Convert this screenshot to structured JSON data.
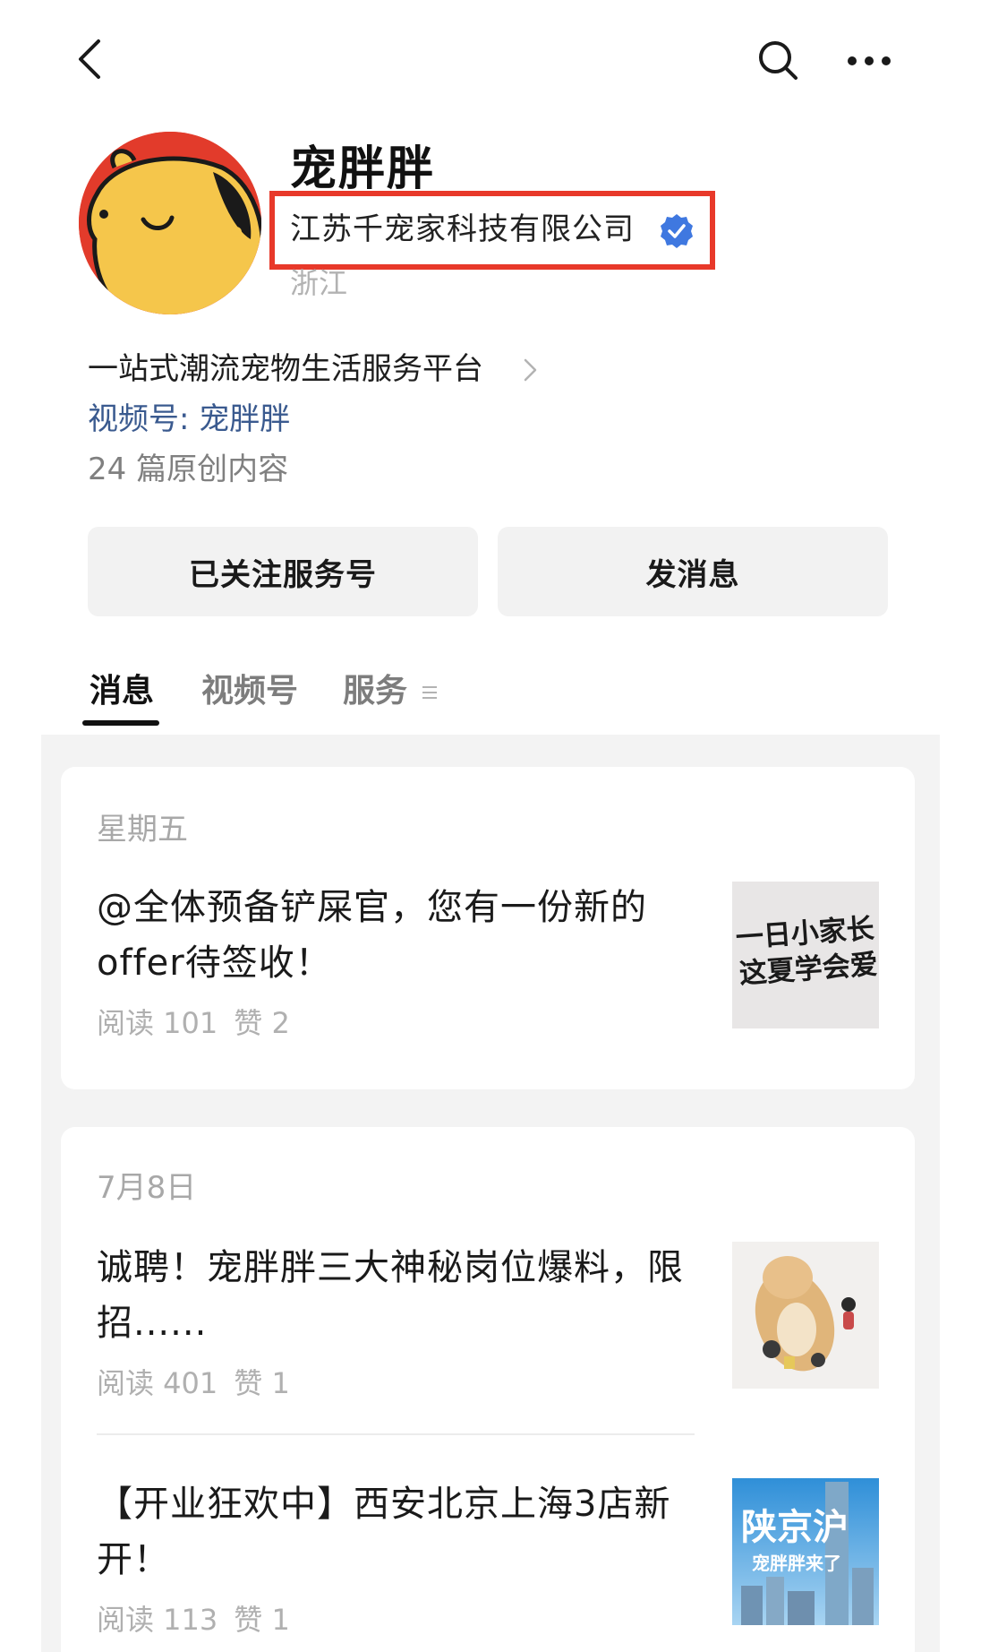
{
  "profile": {
    "name": "宠胖胖",
    "company": "江苏千宠家科技有限公司",
    "region": "浙江",
    "description": "一站式潮流宠物生活服务平台",
    "video_channel": "视频号: 宠胖胖",
    "original_count": "24 篇原创内容"
  },
  "buttons": {
    "follow_label": "已关注服务号",
    "message_label": "发消息"
  },
  "tabs": [
    {
      "label": "消息",
      "active": true
    },
    {
      "label": "视频号",
      "active": false
    },
    {
      "label": "服务",
      "active": false
    }
  ],
  "highlight": {
    "color": "#e8392a"
  },
  "colors": {
    "link": "#3a5a8f",
    "verified": "#3f78e0",
    "avatar_bg": "#e23b2b",
    "avatar_face": "#f5c64b"
  },
  "icons": {
    "back": "back-arrow-icon",
    "search": "search-icon",
    "more": "more-dots-icon",
    "verified": "verified-badge-icon",
    "chevron": "chevron-right-icon",
    "tab_menu": "menu-lines-icon"
  },
  "feed": [
    {
      "date": "星期五",
      "articles": [
        {
          "title": "@全体预备铲屎官，您有一份新的offer待签收！",
          "read": "阅读 101",
          "like": "赞 2",
          "thumb_text": [
            "一日小家长",
            "这夏学会爱"
          ]
        }
      ]
    },
    {
      "date": "7月8日",
      "articles": [
        {
          "title": "诚聘！宠胖胖三大神秘岗位爆料，限招......",
          "read": "阅读 401",
          "like": "赞 1"
        },
        {
          "title": "【开业狂欢中】西安北京上海3店新开！",
          "read": "阅读 113",
          "like": "赞 1",
          "thumb_text": [
            "陕京沪",
            "宠胖胖来了"
          ]
        }
      ]
    }
  ]
}
